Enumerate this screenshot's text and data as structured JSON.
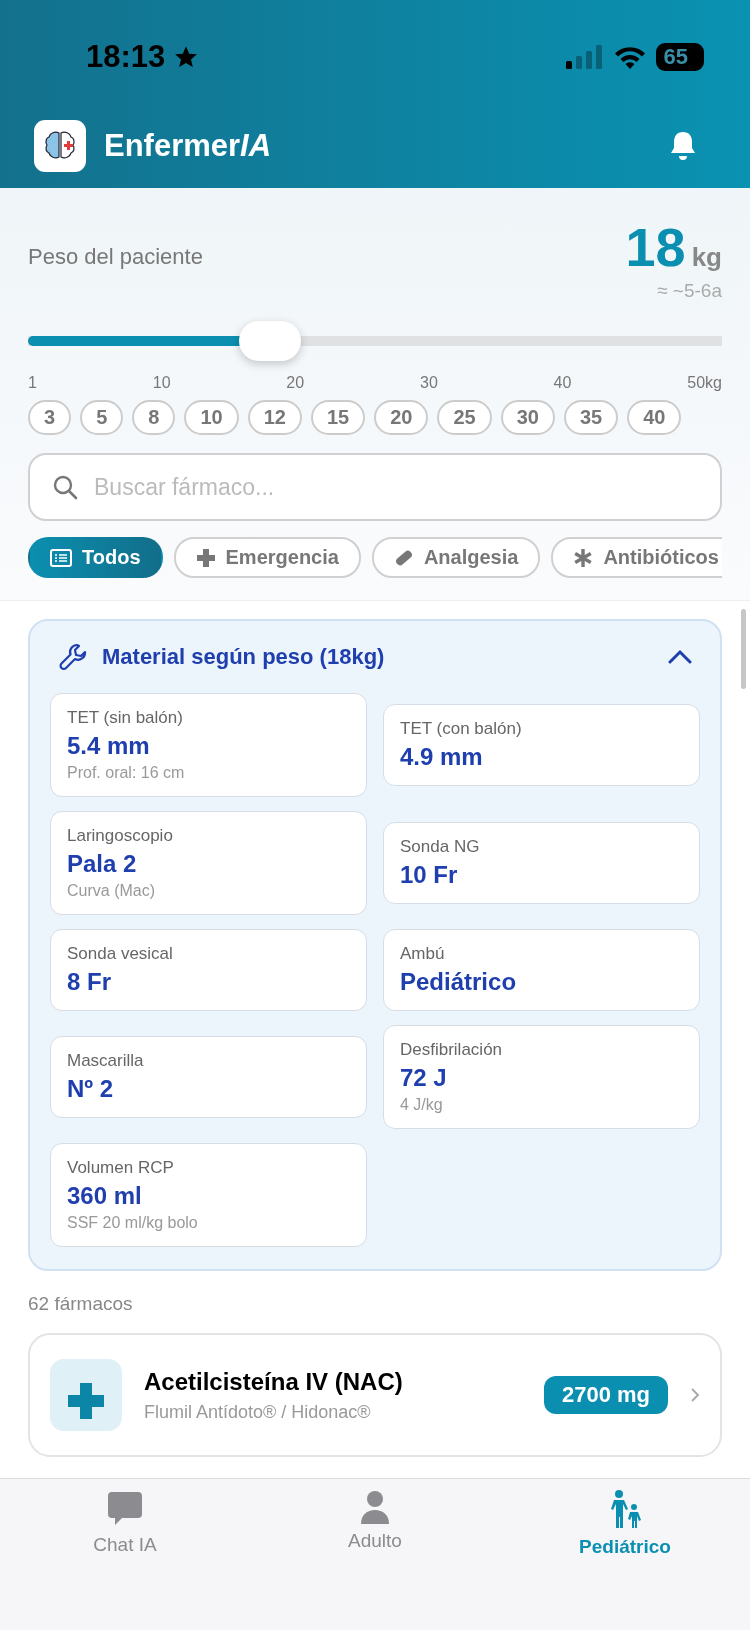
{
  "status_bar": {
    "time": "18:13",
    "battery": "65"
  },
  "app_bar": {
    "title": "Enfermer",
    "title_emphasis": "IA"
  },
  "weight": {
    "label": "Peso del paciente",
    "value": "18",
    "unit": "kg",
    "age": "≈ ~5-6a",
    "level": 0.35,
    "ticks": [
      "1",
      "10",
      "20",
      "30",
      "40",
      "50kg"
    ],
    "presets": [
      {
        "label": "3",
        "selected": false
      },
      {
        "label": "5",
        "selected": false
      },
      {
        "label": "8",
        "selected": false
      },
      {
        "label": "10",
        "selected": false
      },
      {
        "label": "12",
        "selected": false
      },
      {
        "label": "15",
        "selected": false
      },
      {
        "label": "20",
        "selected": false
      },
      {
        "label": "25",
        "selected": false
      },
      {
        "label": "30",
        "selected": false
      },
      {
        "label": "35",
        "selected": false
      },
      {
        "label": "40",
        "selected": false
      }
    ]
  },
  "search": {
    "placeholder": "Buscar fármaco..."
  },
  "categories": [
    {
      "label": "Todos",
      "selected": true
    },
    {
      "label": "Emergencia",
      "selected": false
    },
    {
      "label": "Analgesia",
      "selected": false
    },
    {
      "label": "Antibióticos",
      "selected": false
    }
  ],
  "material": {
    "title": "Material según peso (18kg)",
    "expanded": true,
    "items": [
      {
        "label": "TET (sin balón)",
        "value": "5.4 mm",
        "note": "Prof. oral: 16 cm"
      },
      {
        "label": "Laringoscopio",
        "value": "Pala 2",
        "note": "Curva (Mac)"
      },
      {
        "label": "Sonda vesical",
        "value": "8 Fr"
      },
      {
        "label": "Mascarilla",
        "value": "Nº 2"
      },
      {
        "label": "Volumen RCP",
        "value": "360 ml",
        "note": "SSF 20 ml/kg bolo"
      },
      {
        "label": "TET (con balón)",
        "value": "4.9 mm"
      },
      {
        "label": "Sonda NG",
        "value": "10 Fr"
      },
      {
        "label": "Ambú",
        "value": "Pediátrico"
      },
      {
        "label": "Desfibrilación",
        "value": "72 J",
        "note": "4 J/kg"
      }
    ]
  },
  "count": "62 fármacos",
  "drugs": [
    {
      "name": "Acetilcisteína IV (NAC)",
      "brand": "Flumil Antídoto® / Hidonac®",
      "dose": "2700 mg"
    }
  ],
  "tabs": [
    {
      "label": "Chat IA",
      "selected": false
    },
    {
      "label": "Adulto",
      "selected": false
    },
    {
      "label": "Pediátrico",
      "selected": true
    }
  ]
}
